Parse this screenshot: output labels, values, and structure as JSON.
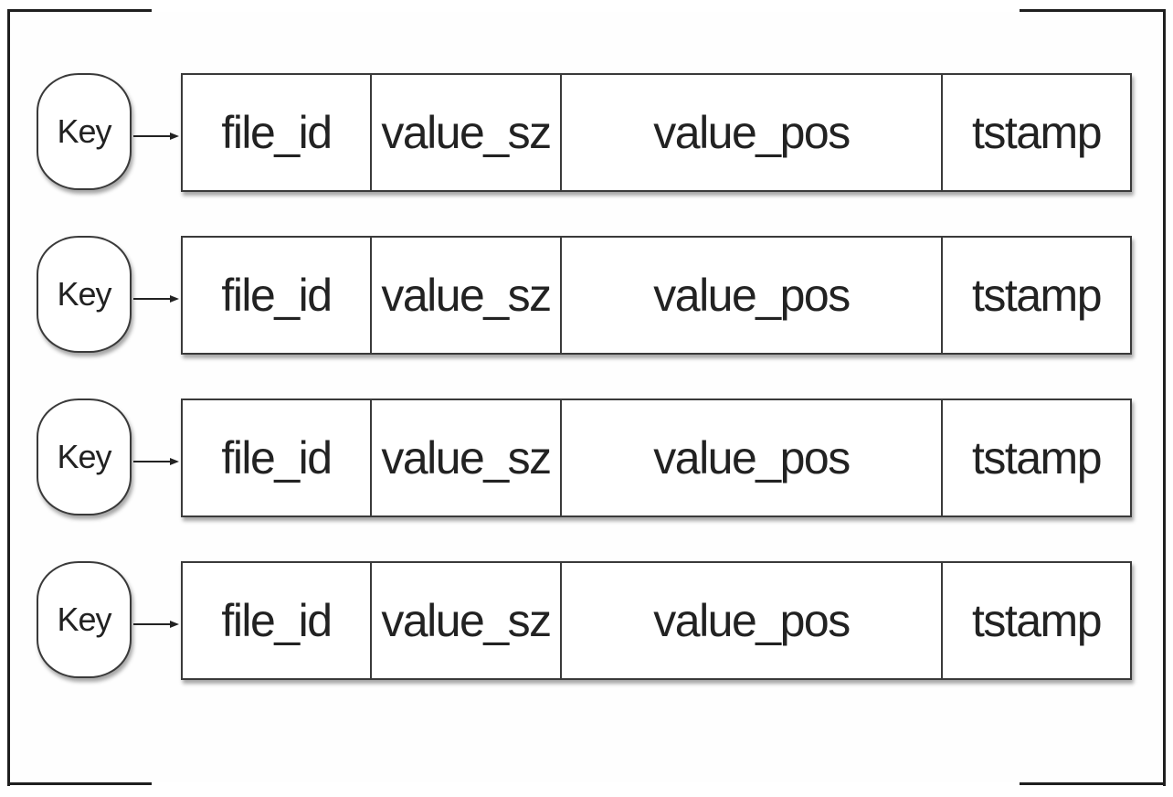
{
  "records": [
    {
      "key": "Key",
      "fields": [
        "file_id",
        "value_sz",
        "value_pos",
        "tstamp"
      ]
    },
    {
      "key": "Key",
      "fields": [
        "file_id",
        "value_sz",
        "value_pos",
        "tstamp"
      ]
    },
    {
      "key": "Key",
      "fields": [
        "file_id",
        "value_sz",
        "value_pos",
        "tstamp"
      ]
    },
    {
      "key": "Key",
      "fields": [
        "file_id",
        "value_sz",
        "value_pos",
        "tstamp"
      ]
    }
  ],
  "colors": {
    "stroke": "#3a3a3a",
    "text": "#222222",
    "background": "#ffffff"
  }
}
